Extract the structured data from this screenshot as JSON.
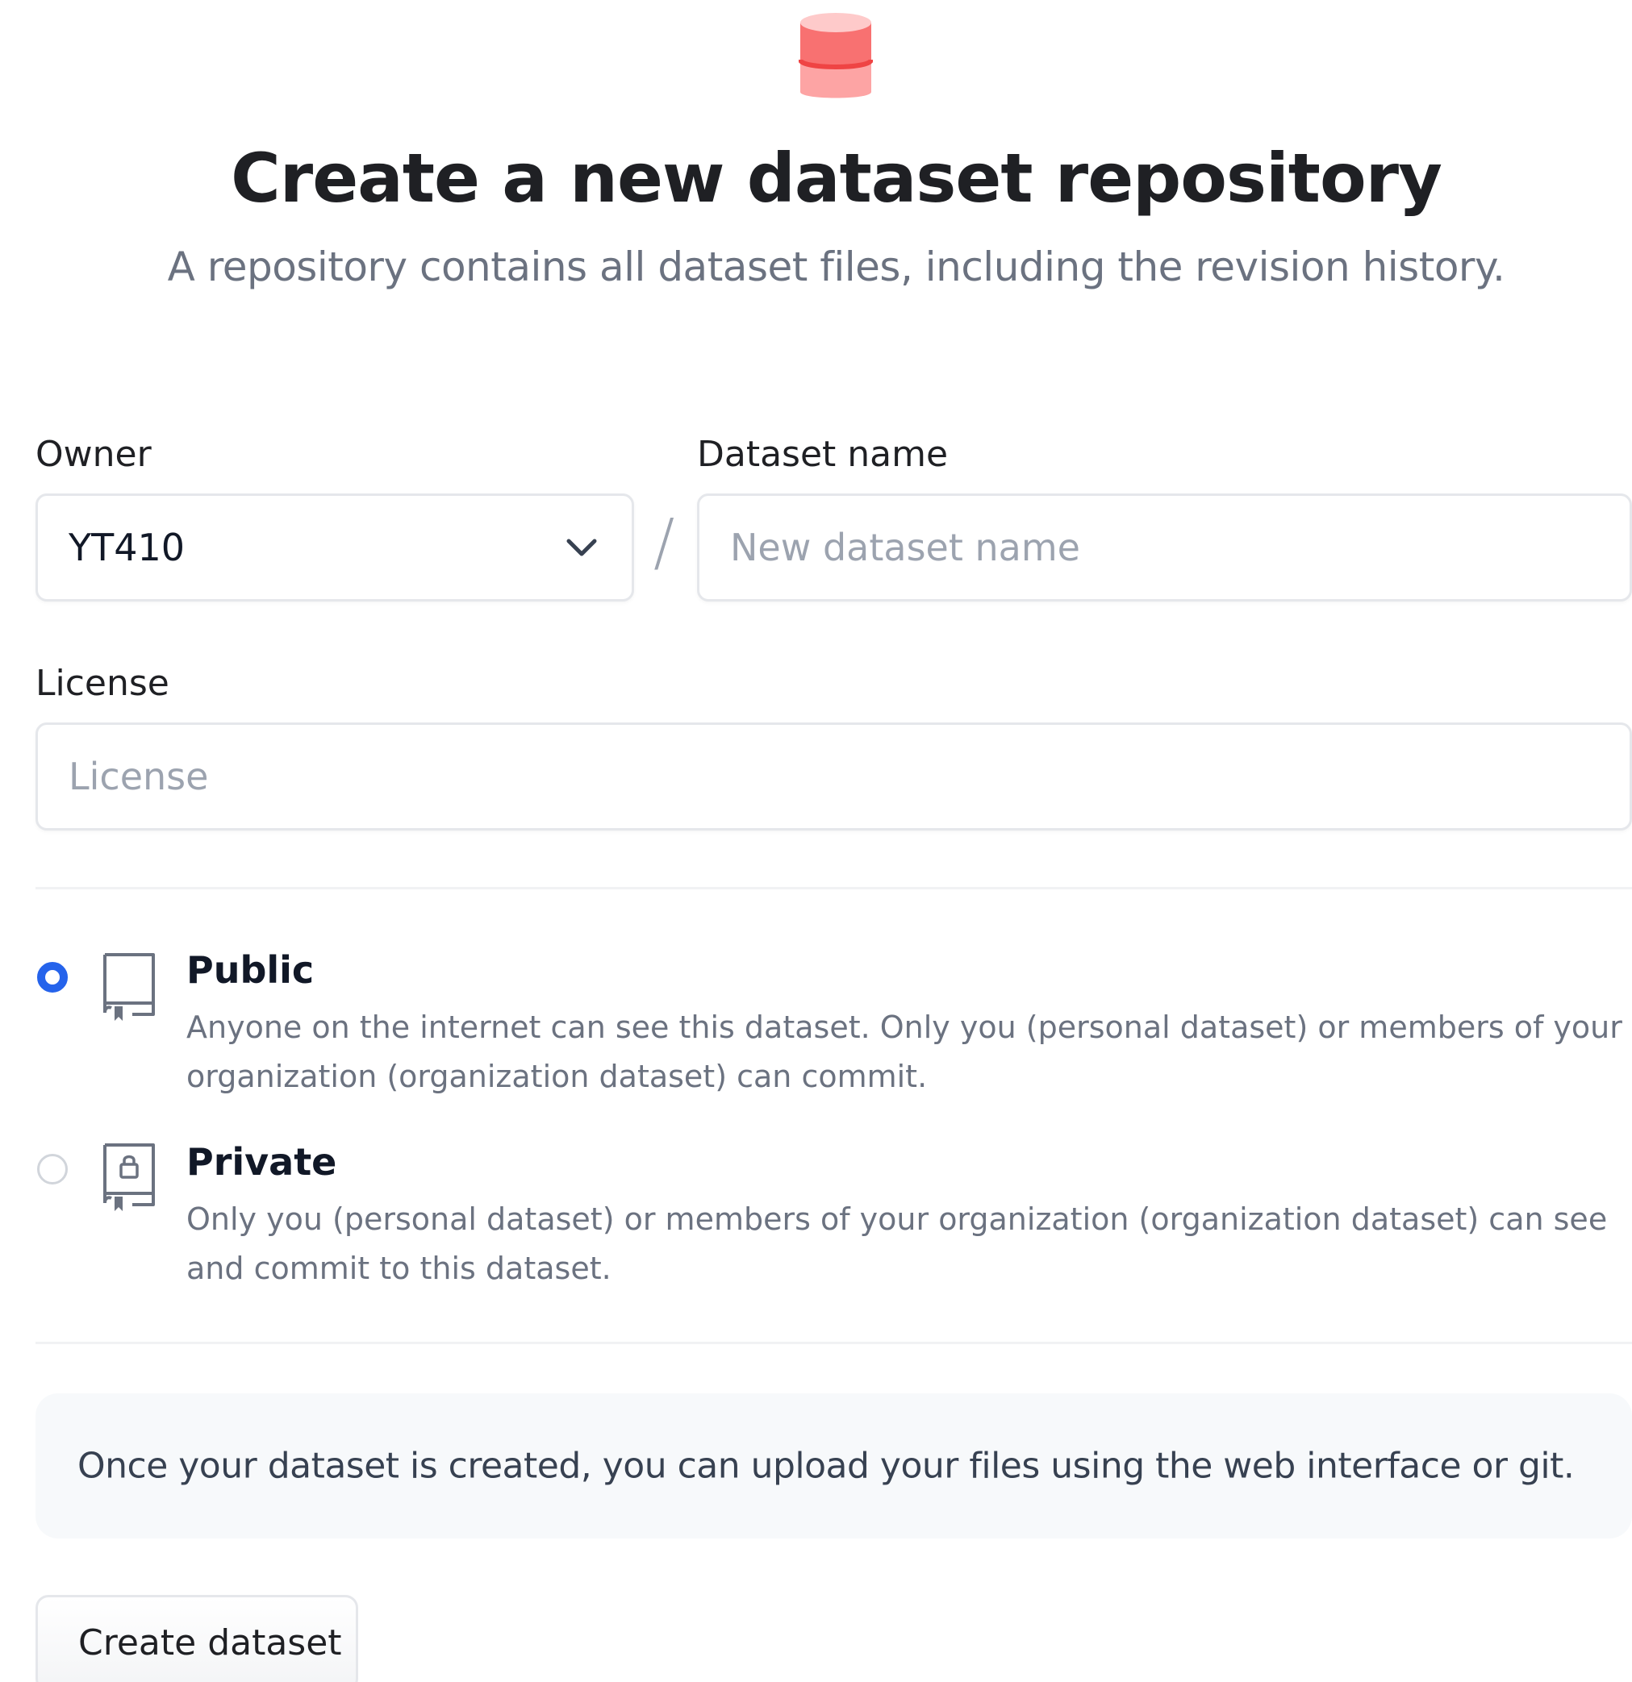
{
  "header": {
    "logo_icon": "dataset-cylinder-icon",
    "title": "Create a new dataset repository",
    "subtitle": "A repository contains all dataset files, including the revision history."
  },
  "form": {
    "owner": {
      "label": "Owner",
      "value": "YT410",
      "icon": "chevron-down-icon"
    },
    "separator": "/",
    "dataset_name": {
      "label": "Dataset name",
      "value": "",
      "placeholder": "New dataset name"
    },
    "license": {
      "label": "License",
      "value": "",
      "placeholder": "License"
    },
    "visibility": {
      "selected": "public",
      "options": [
        {
          "id": "public",
          "title": "Public",
          "description": "Anyone on the internet can see this dataset. Only you (personal dataset) or members of your organization (organization dataset) can commit.",
          "icon": "repo-book-icon"
        },
        {
          "id": "private",
          "title": "Private",
          "description": "Only you (personal dataset) or members of your organization (organization dataset) can see and commit to this dataset.",
          "icon": "repo-lock-icon"
        }
      ]
    },
    "note": "Once your dataset is created, you can upload your files using the web interface or git.",
    "submit_label": "Create dataset"
  },
  "colors": {
    "accent": "#2563eb",
    "logo": "#ef4444",
    "muted_text": "#6b7280",
    "border": "#e5e7eb"
  }
}
